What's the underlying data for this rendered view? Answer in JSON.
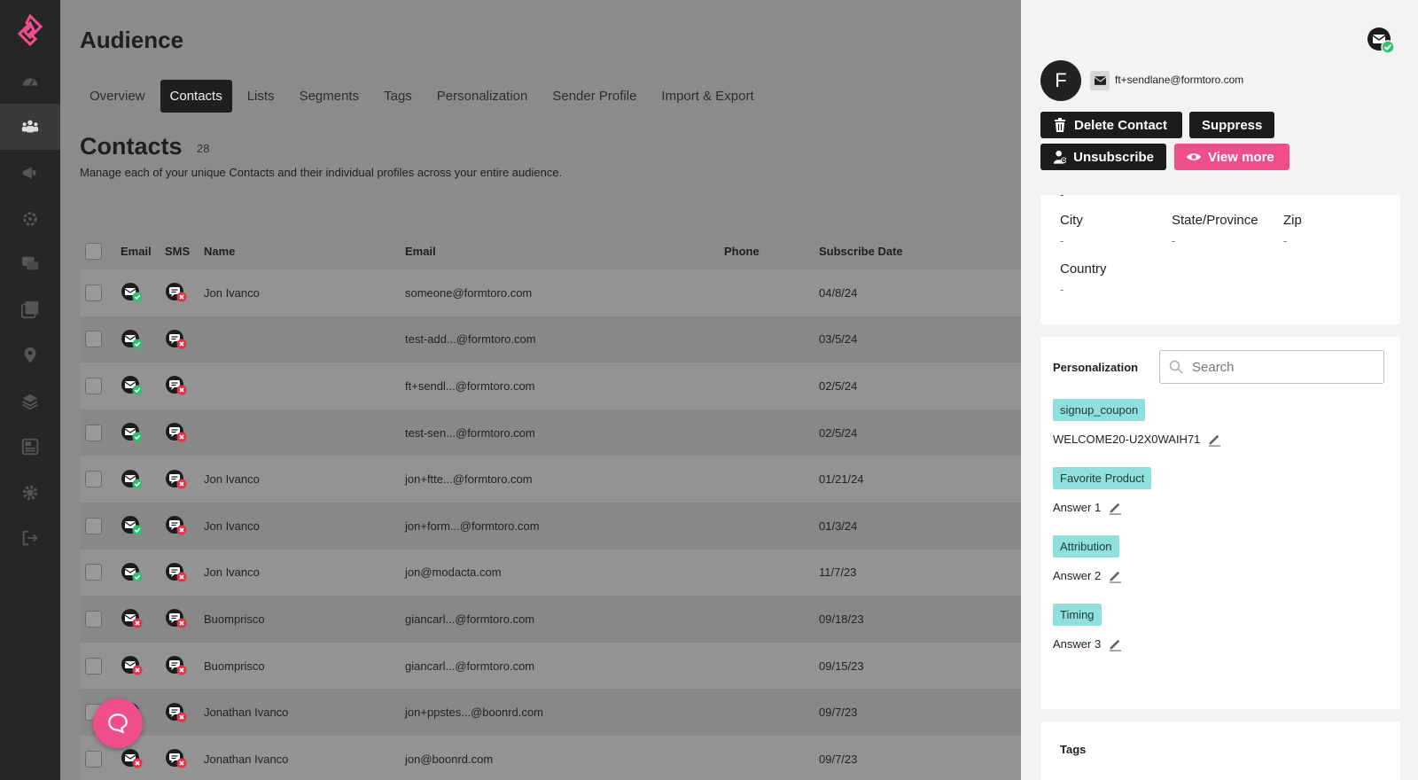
{
  "app": {
    "title": "Audience"
  },
  "tabs": [
    {
      "label": "Overview"
    },
    {
      "label": "Contacts",
      "active": true
    },
    {
      "label": "Lists"
    },
    {
      "label": "Segments"
    },
    {
      "label": "Tags"
    },
    {
      "label": "Personalization"
    },
    {
      "label": "Sender Profile"
    },
    {
      "label": "Import & Export"
    }
  ],
  "section": {
    "title": "Contacts",
    "count": "28",
    "description": "Manage each of your unique Contacts and their individual profiles across your entire audience."
  },
  "table": {
    "headers": {
      "email_status": "Email",
      "sms_status": "SMS",
      "name": "Name",
      "email": "Email",
      "phone": "Phone",
      "date": "Subscribe Date"
    },
    "rows": [
      {
        "name": "Jon Ivanco",
        "email": "someone@formtoro.com",
        "phone": "",
        "date": "04/8/24",
        "email_ok": true,
        "sms_ok": false
      },
      {
        "name": "",
        "email": "test-add...@formtoro.com",
        "phone": "",
        "date": "03/5/24",
        "email_ok": true,
        "sms_ok": false
      },
      {
        "name": "",
        "email": "ft+sendl...@formtoro.com",
        "phone": "",
        "date": "02/5/24",
        "email_ok": true,
        "sms_ok": false
      },
      {
        "name": "",
        "email": "test-sen...@formtoro.com",
        "phone": "",
        "date": "02/5/24",
        "email_ok": true,
        "sms_ok": false
      },
      {
        "name": "Jon Ivanco",
        "email": "jon+ftte...@formtoro.com",
        "phone": "",
        "date": "01/21/24",
        "email_ok": true,
        "sms_ok": false
      },
      {
        "name": "Jon Ivanco",
        "email": "jon+form...@formtoro.com",
        "phone": "",
        "date": "01/3/24",
        "email_ok": true,
        "sms_ok": false
      },
      {
        "name": "Jon Ivanco",
        "email": "jon@modacta.com",
        "phone": "",
        "date": "11/7/23",
        "email_ok": true,
        "sms_ok": false
      },
      {
        "name": "Buomprisco",
        "email": "giancarl...@formtoro.com",
        "phone": "",
        "date": "09/18/23",
        "email_ok": false,
        "sms_ok": false
      },
      {
        "name": "Buomprisco",
        "email": "giancarl...@formtoro.com",
        "phone": "",
        "date": "09/15/23",
        "email_ok": false,
        "sms_ok": false
      },
      {
        "name": "Jonathan Ivanco",
        "email": "jon+ppstes...@boonrd.com",
        "phone": "",
        "date": "09/7/23",
        "email_ok": false,
        "sms_ok": false
      },
      {
        "name": "Jonathan Ivanco",
        "email": "jon@boonrd.com",
        "phone": "",
        "date": "09/7/23",
        "email_ok": false,
        "sms_ok": false
      }
    ]
  },
  "panel": {
    "avatar_letter": "F",
    "contact_email": "ft+sendlane@formtoro.com",
    "buttons": {
      "delete": "Delete Contact",
      "suppress": "Suppress",
      "unsubscribe": "Unsubscribe",
      "view_more": "View more"
    },
    "address": {
      "top_dash": "-",
      "city_label": "City",
      "city_value": "-",
      "state_label": "State/Province",
      "state_value": "-",
      "zip_label": "Zip",
      "zip_value": "-",
      "country_label": "Country",
      "country_value": "-"
    },
    "personalization": {
      "title": "Personalization",
      "search_placeholder": "Search",
      "items": [
        {
          "key": "signup_coupon",
          "value": "WELCOME20-U2X0WAIH71"
        },
        {
          "key": "Favorite Product",
          "value": "Answer 1"
        },
        {
          "key": "Attribution",
          "value": "Answer 2"
        },
        {
          "key": "Timing",
          "value": "Answer 3"
        }
      ]
    },
    "tags_title": "Tags"
  },
  "colors": {
    "accent": "#f04e8a",
    "chip": "#8fe0dc",
    "ok": "#2fbf71",
    "error": "#e5334b"
  }
}
